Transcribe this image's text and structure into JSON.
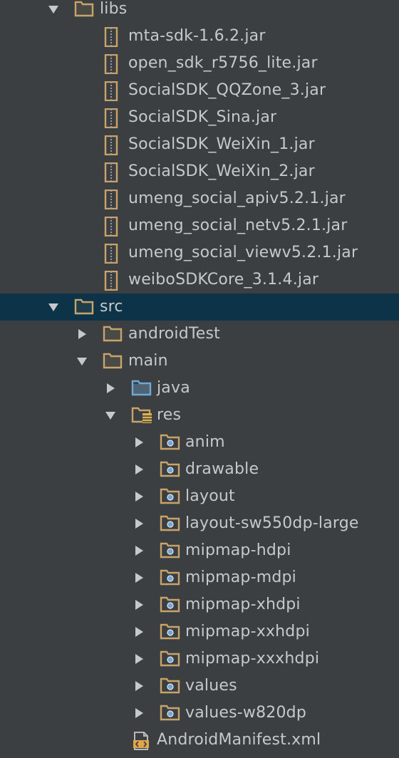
{
  "colors": {
    "background": "#3c3f41",
    "selection": "#0d3349",
    "text": "#c5c9cc",
    "folder": "#c9a46a",
    "source_folder": "#6fa8d6",
    "arrow": "#c5c9cc"
  },
  "tree": [
    {
      "label": "libs",
      "level": 0,
      "kind": "folder",
      "icon": "folder-icon",
      "arrow": "expanded"
    },
    {
      "label": "mta-sdk-1.6.2.jar",
      "level": 1,
      "kind": "jar",
      "icon": "jar-icon",
      "arrow": "none"
    },
    {
      "label": "open_sdk_r5756_lite.jar",
      "level": 1,
      "kind": "jar",
      "icon": "jar-icon",
      "arrow": "none"
    },
    {
      "label": "SocialSDK_QQZone_3.jar",
      "level": 1,
      "kind": "jar",
      "icon": "jar-icon",
      "arrow": "none"
    },
    {
      "label": "SocialSDK_Sina.jar",
      "level": 1,
      "kind": "jar",
      "icon": "jar-icon",
      "arrow": "none"
    },
    {
      "label": "SocialSDK_WeiXin_1.jar",
      "level": 1,
      "kind": "jar",
      "icon": "jar-icon",
      "arrow": "none"
    },
    {
      "label": "SocialSDK_WeiXin_2.jar",
      "level": 1,
      "kind": "jar",
      "icon": "jar-icon",
      "arrow": "none"
    },
    {
      "label": "umeng_social_apiv5.2.1.jar",
      "level": 1,
      "kind": "jar",
      "icon": "jar-icon",
      "arrow": "none"
    },
    {
      "label": "umeng_social_netv5.2.1.jar",
      "level": 1,
      "kind": "jar",
      "icon": "jar-icon",
      "arrow": "none"
    },
    {
      "label": "umeng_social_viewv5.2.1.jar",
      "level": 1,
      "kind": "jar",
      "icon": "jar-icon",
      "arrow": "none"
    },
    {
      "label": "weiboSDKCore_3.1.4.jar",
      "level": 1,
      "kind": "jar",
      "icon": "jar-icon",
      "arrow": "none"
    },
    {
      "label": "src",
      "level": 0,
      "kind": "folder",
      "icon": "folder-icon",
      "arrow": "expanded",
      "selected": true
    },
    {
      "label": "androidTest",
      "level": 1,
      "kind": "folder",
      "icon": "folder-icon",
      "arrow": "collapsed"
    },
    {
      "label": "main",
      "level": 1,
      "kind": "folder",
      "icon": "folder-icon",
      "arrow": "expanded"
    },
    {
      "label": "java",
      "level": 2,
      "kind": "source",
      "icon": "source-folder-icon",
      "arrow": "collapsed"
    },
    {
      "label": "res",
      "level": 2,
      "kind": "res",
      "icon": "resource-folder-icon",
      "arrow": "expanded"
    },
    {
      "label": "anim",
      "level": 3,
      "kind": "package",
      "icon": "package-folder-icon",
      "arrow": "collapsed"
    },
    {
      "label": "drawable",
      "level": 3,
      "kind": "package",
      "icon": "package-folder-icon",
      "arrow": "collapsed"
    },
    {
      "label": "layout",
      "level": 3,
      "kind": "package",
      "icon": "package-folder-icon",
      "arrow": "collapsed"
    },
    {
      "label": "layout-sw550dp-large",
      "level": 3,
      "kind": "package",
      "icon": "package-folder-icon",
      "arrow": "collapsed"
    },
    {
      "label": "mipmap-hdpi",
      "level": 3,
      "kind": "package",
      "icon": "package-folder-icon",
      "arrow": "collapsed"
    },
    {
      "label": "mipmap-mdpi",
      "level": 3,
      "kind": "package",
      "icon": "package-folder-icon",
      "arrow": "collapsed"
    },
    {
      "label": "mipmap-xhdpi",
      "level": 3,
      "kind": "package",
      "icon": "package-folder-icon",
      "arrow": "collapsed"
    },
    {
      "label": "mipmap-xxhdpi",
      "level": 3,
      "kind": "package",
      "icon": "package-folder-icon",
      "arrow": "collapsed"
    },
    {
      "label": "mipmap-xxxhdpi",
      "level": 3,
      "kind": "package",
      "icon": "package-folder-icon",
      "arrow": "collapsed"
    },
    {
      "label": "values",
      "level": 3,
      "kind": "package",
      "icon": "package-folder-icon",
      "arrow": "collapsed"
    },
    {
      "label": "values-w820dp",
      "level": 3,
      "kind": "package",
      "icon": "package-folder-icon",
      "arrow": "collapsed"
    },
    {
      "label": "AndroidManifest.xml",
      "level": 2,
      "kind": "xml",
      "icon": "xml-file-icon",
      "arrow": "none"
    }
  ]
}
